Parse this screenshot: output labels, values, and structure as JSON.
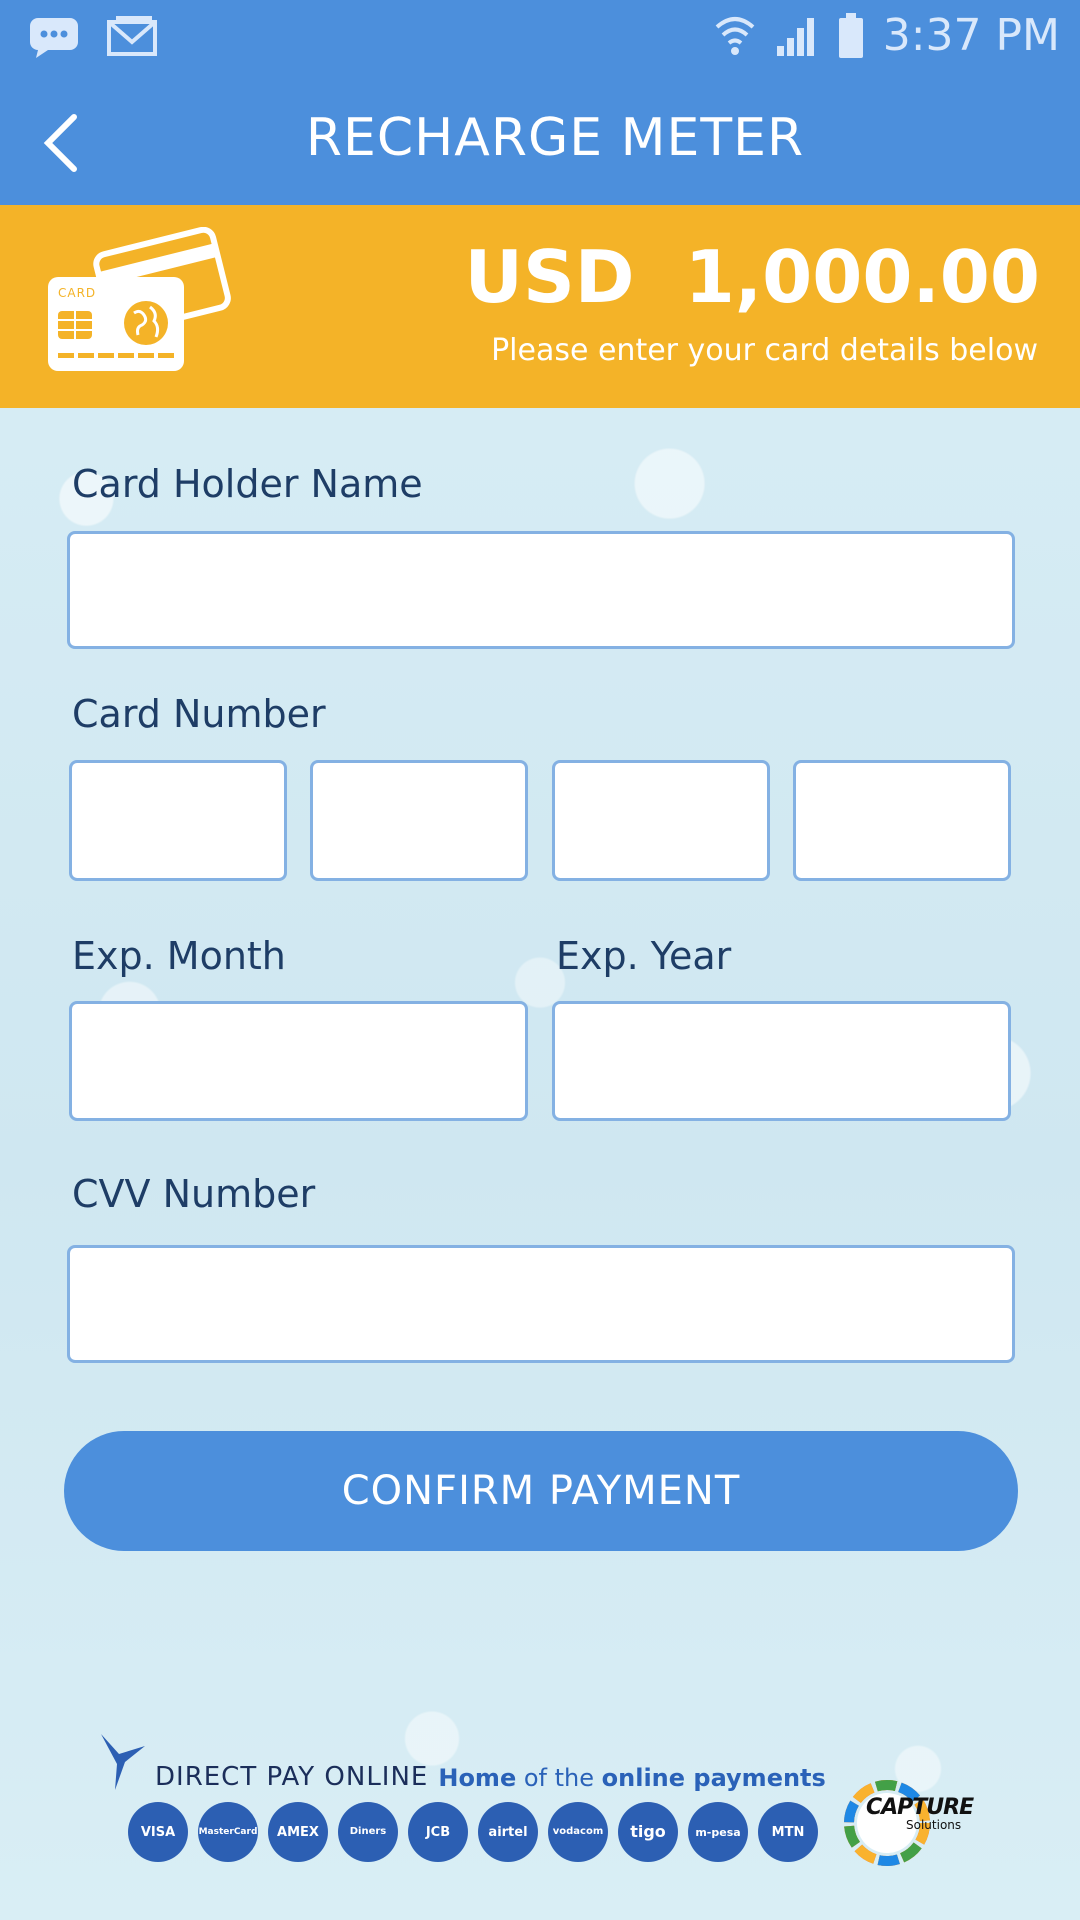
{
  "status_bar": {
    "time": "3:37 PM",
    "icons": [
      "chat-icon",
      "gmail-icon",
      "wifi-icon",
      "signal-icon",
      "battery-icon"
    ]
  },
  "app_bar": {
    "title": "RECHARGE METER",
    "back_icon": "chevron-left-icon"
  },
  "banner": {
    "amount": "USD  1,000.00",
    "subtitle": "Please enter your card details below",
    "card_icon_label": "CARD",
    "color": "#f4b328"
  },
  "form": {
    "card_holder_label": "Card Holder Name",
    "card_holder_value": "",
    "card_number_label": "Card Number",
    "card_number_parts": [
      "",
      "",
      "",
      ""
    ],
    "exp_month_label": "Exp. Month",
    "exp_month_value": "",
    "exp_year_label": "Exp. Year",
    "exp_year_value": "",
    "cvv_label": "CVV Number",
    "cvv_value": ""
  },
  "confirm_button": "CONFIRM PAYMENT",
  "footer": {
    "brand": "DIRECT PAY ONLINE",
    "tagline_1": "Home",
    "tagline_2": "of the",
    "tagline_3": "online payments",
    "payment_methods": [
      "VISA",
      "MasterCard",
      "AMEX",
      "Diners",
      "JCB",
      "airtel",
      "vodacom",
      "tigo",
      "m-pesa",
      "MTN"
    ],
    "partner": "CAPTURE",
    "partner_sub": "Solutions"
  },
  "colors": {
    "primary": "#4c8fdc",
    "accent": "#f4b328",
    "label": "#1e3d66"
  }
}
